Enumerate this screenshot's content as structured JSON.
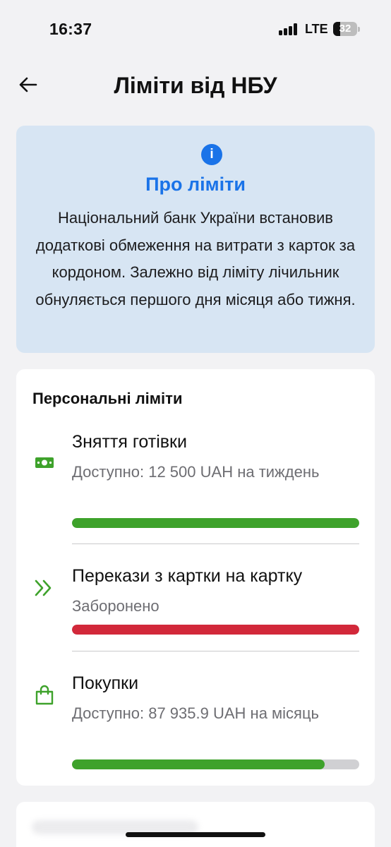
{
  "status_bar": {
    "time": "16:37",
    "network": "LTE",
    "battery": "32"
  },
  "header": {
    "title": "Ліміти від НБУ",
    "back_icon": "arrow-left-icon"
  },
  "info": {
    "icon": "info-icon",
    "icon_glyph": "i",
    "title": "Про ліміти",
    "text": "Національний банк України встановив додаткові обмеження на витрати з карток за кордоном. Залежно від ліміту лічильник обнуляється першого дня місяця або тижня."
  },
  "limits": {
    "heading": "Персональні ліміти",
    "items": [
      {
        "icon": "cash-icon",
        "title": "Зняття готівки",
        "subtitle": "Доступно: 12 500 UAH на тиждень",
        "progress": 1.0,
        "color": "#3ea22b"
      },
      {
        "icon": "double-chevron-right-icon",
        "title": "Перекази з картки на картку",
        "subtitle": "Заборонено",
        "progress": 1.0,
        "color": "#d2283a"
      },
      {
        "icon": "shopping-bag-icon",
        "title": "Покупки",
        "subtitle": "Доступно: 87 935.9 UAH на місяць",
        "progress": 0.88,
        "color": "#3ea22b"
      }
    ]
  },
  "colors": {
    "accent": "#1a73e8",
    "success": "#3ea22b",
    "danger": "#d2283a",
    "info_bg": "#d7e5f3"
  }
}
